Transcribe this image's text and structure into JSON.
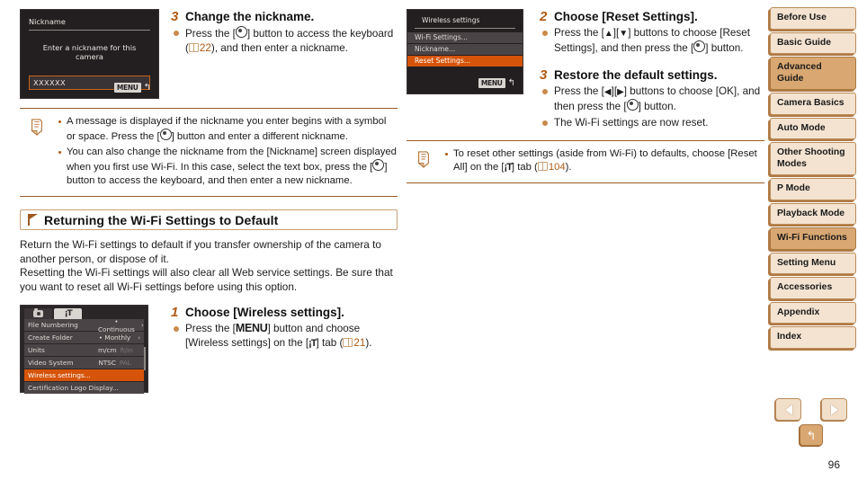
{
  "document": {
    "page_number": "96"
  },
  "left_column": {
    "step3": {
      "number": "3",
      "title": "Change the nickname.",
      "bullets": [
        {
          "pre": "Press the [",
          "token": "func-button-icon",
          "mid": "] button to access the keyboard (",
          "page_ref": "22",
          "post": "), and then enter a nickname."
        }
      ]
    },
    "nickname_screen": {
      "title": "Nickname",
      "prompt": "Enter a nickname for this camera",
      "textbox_value": "XXXXXX",
      "menu_label": "MENU",
      "back_arrow": "↰"
    },
    "note1": {
      "items": [
        {
          "pre": "A message is displayed if the nickname you enter begins with a symbol or space. Press the [",
          "token": "func-button-icon",
          "post": "] button and enter a different nickname."
        },
        {
          "pre": "You can also change the nickname from the [Nickname] screen displayed when you first use Wi-Fi. In this case, select the text box, press the [",
          "token": "func-button-icon",
          "post": "] button to access the keyboard, and then enter a new nickname."
        }
      ]
    },
    "section": {
      "heading": "Returning the Wi-Fi Settings to Default",
      "paragraph1": "Return the Wi-Fi settings to default if you transfer ownership of the camera to another person, or dispose of it.",
      "paragraph2": "Resetting the Wi-Fi settings will also clear all Web service settings. Be sure that you want to reset all Wi-Fi settings before using this option."
    },
    "settings_menu_screen": {
      "tabs": [
        "camera-tab-icon",
        "wrench-tab-icon"
      ],
      "rows": [
        {
          "label": "File Numbering",
          "value": "• Continuous",
          "dim": "",
          "arrow": "›"
        },
        {
          "label": "Create Folder",
          "value": "• Monthly",
          "dim": "",
          "arrow": "›"
        },
        {
          "label": "Units",
          "value": "m/cm",
          "dim": "ft/in",
          "arrow": ""
        },
        {
          "label": "Video System",
          "value": "NTSC",
          "dim": "PAL",
          "arrow": ""
        },
        {
          "label": "Wireless settings...",
          "value": "",
          "dim": "",
          "arrow": "",
          "selected": true
        },
        {
          "label": "Certification Logo Display...",
          "value": "",
          "dim": "",
          "arrow": ""
        }
      ]
    },
    "step1": {
      "number": "1",
      "title": "Choose [Wireless settings].",
      "bullets": [
        {
          "pre": "Press the [",
          "menu_token": "MENU",
          "mid": "] button and choose [Wireless settings] on the [",
          "tab_token": "wrench-tab-icon",
          "mid2": "] tab (",
          "page_ref": "21",
          "post": ")."
        }
      ]
    }
  },
  "right_column": {
    "wireless_screen": {
      "title": "Wireless settings",
      "items": [
        {
          "label": "Wi-Fi Settings...",
          "selected": false
        },
        {
          "label": "Nickname...",
          "selected": false
        },
        {
          "label": "Reset Settings...",
          "selected": true
        }
      ],
      "menu_label": "MENU",
      "back_arrow": "↰"
    },
    "step2": {
      "number": "2",
      "title": "Choose [Reset Settings].",
      "bullets": [
        {
          "pre": "Press the [",
          "up": "▲",
          "mid_sep": "][",
          "down": "▼",
          "mid": "] buttons to choose [Reset Settings], and then press the [",
          "token": "func-button-icon",
          "post": "] button."
        }
      ]
    },
    "step3": {
      "number": "3",
      "title": "Restore the default settings.",
      "bullet1": {
        "pre": "Press the [",
        "left": "◀",
        "mid_sep": "][",
        "right": "▶",
        "mid": "] buttons to choose [OK], and then press the [",
        "token": "func-button-icon",
        "post": "] button."
      },
      "bullet2": "The Wi-Fi settings are now reset."
    },
    "note2": {
      "item": {
        "pre": "To reset other settings (aside from Wi-Fi) to defaults, choose [Reset All] on the [",
        "tab_token": "wrench-tab-icon",
        "mid": "] tab (",
        "page_ref": "104",
        "post": ")."
      }
    }
  },
  "sidebar": {
    "items": [
      {
        "label": "Before Use",
        "active": false
      },
      {
        "label": "Basic Guide",
        "active": false
      },
      {
        "label": "Advanced Guide",
        "active": true
      },
      {
        "label": "Camera Basics",
        "active": false
      },
      {
        "label": "Auto Mode",
        "active": false
      },
      {
        "label": "Other Shooting Modes",
        "active": false
      },
      {
        "label": "P Mode",
        "active": false
      },
      {
        "label": "Playback Mode",
        "active": false
      },
      {
        "label": "Wi-Fi Functions",
        "active": true
      },
      {
        "label": "Setting Menu",
        "active": false
      },
      {
        "label": "Accessories",
        "active": false
      },
      {
        "label": "Appendix",
        "active": false
      },
      {
        "label": "Index",
        "active": false
      }
    ]
  },
  "controls": {
    "prev_label": "prev-page-icon",
    "next_label": "next-page-icon",
    "back_label": "↰"
  },
  "colors": {
    "accent": "#b05a14",
    "selection": "#d6540a",
    "sidebar_bg": "#f3e3d0",
    "sidebar_active": "#d9a771",
    "rule": "#9c5a22"
  }
}
